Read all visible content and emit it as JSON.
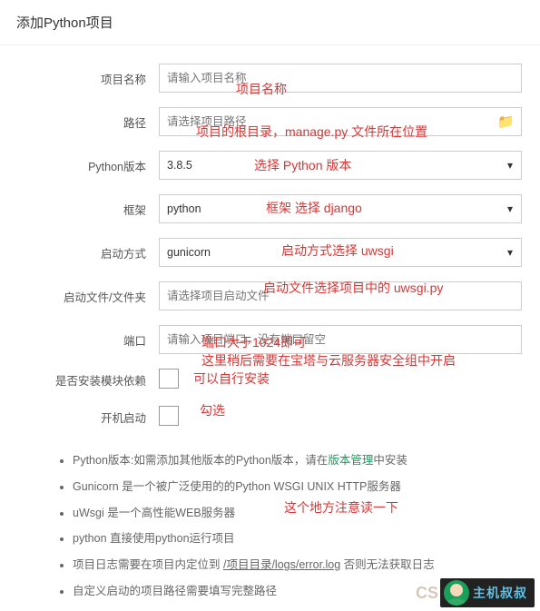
{
  "title": "添加Python项目",
  "labels": {
    "project_name": "项目名称",
    "path": "路径",
    "python_version": "Python版本",
    "framework": "框架",
    "start_method": "启动方式",
    "start_file": "启动文件/文件夹",
    "port": "端口",
    "install_deps": "是否安装模块依赖",
    "boot_start": "开机启动"
  },
  "placeholders": {
    "project_name": "请输入项目名称",
    "path": "请选择项目路径",
    "start_file": "请选择项目启动文件",
    "port": "请输入项目端口，没有端口留空"
  },
  "values": {
    "python_version": "3.8.5",
    "framework": "python",
    "start_method": "gunicorn"
  },
  "notes": {
    "n1a": "Python版本:如需添加其他版本的Python版本，请在",
    "n1b": "版本管理",
    "n1c": "中安装",
    "n2": "Gunicorn 是一个被广泛使用的的Python WSGI UNIX HTTP服务器",
    "n3": "uWsgi 是一个高性能WEB服务器",
    "n4": "python 直接使用python运行项目",
    "n5a": "项目日志需要在项目内定位到 ",
    "n5b": "/项目目录/logs/error.log",
    "n5c": " 否则无法获取日志",
    "n6": "自定义启动的项目路径需要填写完整路径"
  },
  "annotations": {
    "a1": "项目名称",
    "a2": "项目的根目录，manage.py 文件所在位置",
    "a3": "选择 Python 版本",
    "a4": "框架 选择 django",
    "a5": "启动方式选择 uwsgi",
    "a6": "启动文件选择项目中的 uwsgi.py",
    "a7a": "端口大于1024即可",
    "a7b": "这里稍后需要在宝塔与云服务器安全组中开启",
    "a8": "可以自行安装",
    "a9": "勾选",
    "a10": "这个地方注意读一下"
  },
  "badge": {
    "cs": "CS",
    "text": "主机叔叔"
  }
}
